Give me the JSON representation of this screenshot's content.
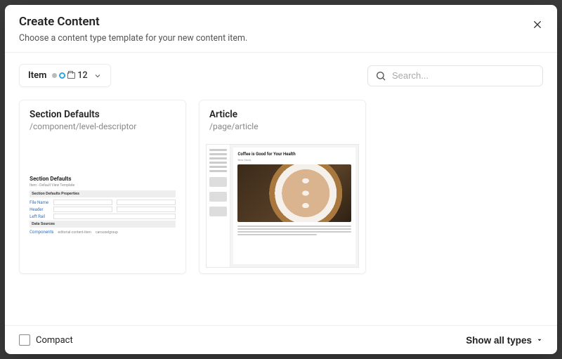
{
  "modal": {
    "title": "Create Content",
    "subtitle": "Choose a content type template for your new content item."
  },
  "toolbar": {
    "filter_label": "Item",
    "filter_count": "12",
    "search_placeholder": "Search..."
  },
  "cards": [
    {
      "title": "Section Defaults",
      "path": "/component/level-descriptor",
      "preview": {
        "heading": "Section Defaults",
        "sub": "Item › Default View Template",
        "group1": "Section Defaults Properties",
        "row1_label": "File Name",
        "row2_label": "Header",
        "row3_label": "Left Rail",
        "group2": "Data Sources",
        "row4_label": "Components",
        "row4_val1": "editorial-content-item",
        "row4_val2": "carouselgroup"
      }
    },
    {
      "title": "Article",
      "path": "/page/article",
      "preview": {
        "article_title": "Coffee is Good for Your Health",
        "article_sub": "New Study"
      }
    }
  ],
  "footer": {
    "compact_label": "Compact",
    "show_all_label": "Show all types"
  }
}
